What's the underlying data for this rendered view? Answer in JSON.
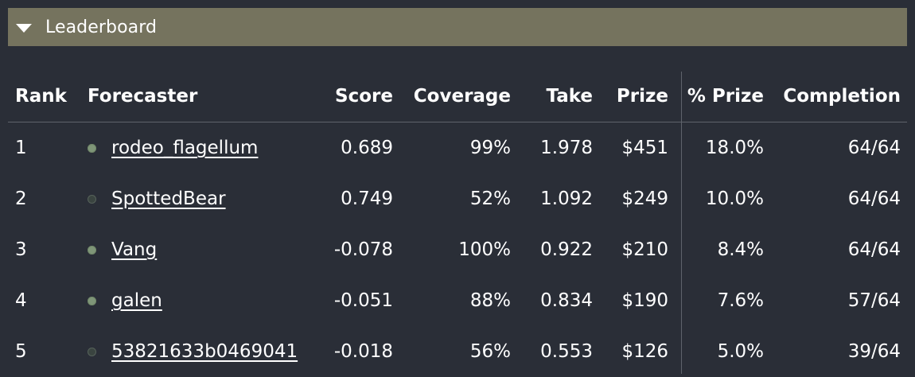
{
  "panel": {
    "title": "Leaderboard"
  },
  "table": {
    "headers": {
      "rank": "Rank",
      "forecaster": "Forecaster",
      "score": "Score",
      "coverage": "Coverage",
      "take": "Take",
      "prize": "Prize",
      "pct_prize": "% Prize",
      "completion": "Completion"
    },
    "rows": [
      {
        "rank": "1",
        "forecaster": "rodeo_flagellum",
        "dot": "filled",
        "score": "0.689",
        "coverage": "99%",
        "take": "1.978",
        "prize": "$451",
        "pct_prize": "18.0%",
        "completion": "64/64"
      },
      {
        "rank": "2",
        "forecaster": "SpottedBear",
        "dot": "hollow",
        "score": "0.749",
        "coverage": "52%",
        "take": "1.092",
        "prize": "$249",
        "pct_prize": "10.0%",
        "completion": "64/64"
      },
      {
        "rank": "3",
        "forecaster": "Vang",
        "dot": "filled",
        "score": "-0.078",
        "coverage": "100%",
        "take": "0.922",
        "prize": "$210",
        "pct_prize": "8.4%",
        "completion": "64/64"
      },
      {
        "rank": "4",
        "forecaster": "galen",
        "dot": "filled",
        "score": "-0.051",
        "coverage": "88%",
        "take": "0.834",
        "prize": "$190",
        "pct_prize": "7.6%",
        "completion": "57/64"
      },
      {
        "rank": "5",
        "forecaster": "53821633b0469041",
        "dot": "hollow",
        "score": "-0.018",
        "coverage": "56%",
        "take": "0.553",
        "prize": "$126",
        "pct_prize": "5.0%",
        "completion": "39/64"
      }
    ]
  },
  "colors": {
    "background": "#2a2e37",
    "header_bar": "#75735e",
    "dot_active": "#7f9678",
    "dot_inactive": "#3a4440",
    "divider": "#5f636b"
  }
}
